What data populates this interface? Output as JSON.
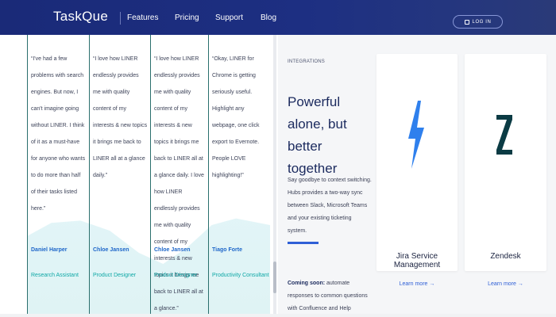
{
  "header": {
    "logo_text": "TaskQue",
    "nav": [
      "Features",
      "Pricing",
      "Support",
      "Blog"
    ],
    "login_label": "LOG IN"
  },
  "testimonials": [
    {
      "quote": "“I've had a few problems with search engines. But now, I can't imagine going without LINER. I think of it as a must-have for anyone who wants to do more than half of their tasks listed here.”",
      "name": "Daniel Harper",
      "role": "Research Assistant"
    },
    {
      "quote": "“I love how LINER endlessly provides me with quality content of my interests & new topics it brings me back to LINER all at a glance daily.”",
      "name": "Chloe Jansen",
      "role": "Product Designer"
    },
    {
      "quote": "“I love how LINER endlessly provides me with quality content of my interests & new topics it brings me back to LINER all at a glance daily. I love how LINER endlessly provides me with quality content of my interests & new topics it brings me back to LINER all at a glance.”",
      "name": "Chloe Jansen",
      "role": "Product Designer"
    },
    {
      "quote": "“Okay, LINER for Chrome is getting seriously useful. Highlight any webpage, one click export to Evernote. People LOVE highlighting!”",
      "name": "Tiago Forte",
      "role": "Productivity Consultant"
    }
  ],
  "integrations": {
    "kicker": "INTEGRATIONS",
    "headline": "Powerful alone, but better together",
    "description": "Say goodbye to context switching. Hubs provides a two-way sync between Slack, Microsoft Teams and your existing ticketing system.",
    "coming_bold": "Coming soon:",
    "coming_text": "automate responses to common questions with Confluence and Help Answers",
    "cards": [
      {
        "title": "Jira Service Management",
        "link": "Learn more →",
        "icon": "jira-icon"
      },
      {
        "title": "Zendesk",
        "link": "Learn more →",
        "icon": "zendesk-icon"
      }
    ]
  },
  "colors": {
    "header": "#1d2f82",
    "accent": "#2f5fd6",
    "teal": "#0ea8a6",
    "name_blue": "#1e66c9"
  }
}
